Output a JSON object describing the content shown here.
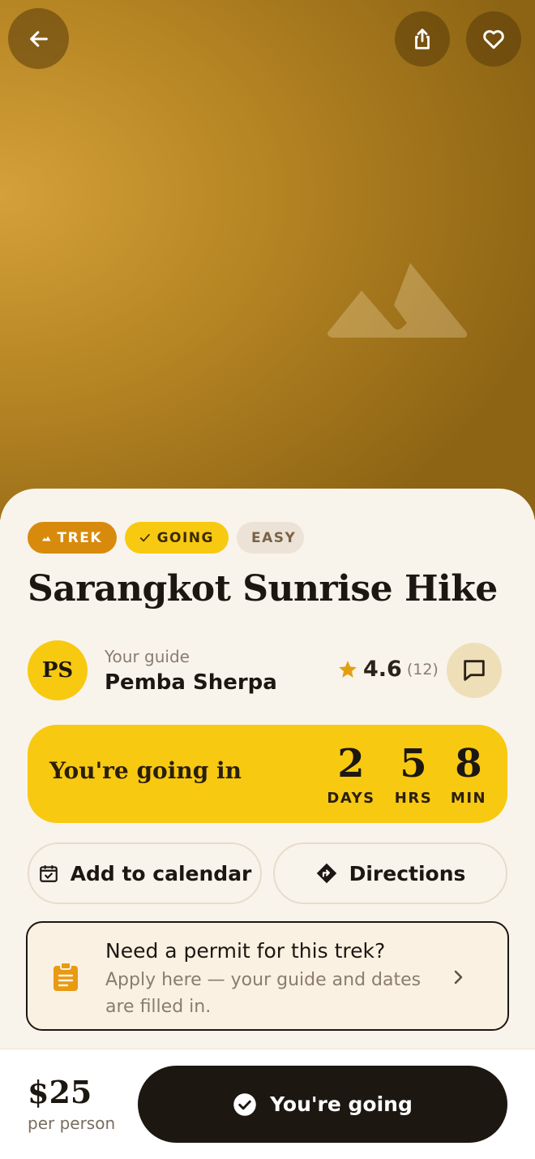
{
  "hero": {
    "back_icon": "arrow-left-icon",
    "share_icon": "share-icon",
    "favorite_icon": "heart-icon",
    "image_icon": "mountain-icon"
  },
  "tags": [
    {
      "label": "TREK",
      "icon": "mountain-icon",
      "color": "#d88a0c"
    },
    {
      "label": "GOING",
      "icon": "check-icon",
      "color": "#f8c911"
    },
    {
      "label": "EASY",
      "color": "#ece3d6"
    }
  ],
  "trek": {
    "title": "Sarangkot Sunrise Hike"
  },
  "guide": {
    "initials": "PS",
    "label": "Your guide",
    "name": "Pemba Sherpa",
    "rating": "4.6",
    "rating_count": "(12)",
    "message_icon": "chat-bubble-icon"
  },
  "countdown": {
    "label": "You're going in",
    "units": [
      {
        "value": "2",
        "label": "DAYS"
      },
      {
        "value": "5",
        "label": "HRS"
      },
      {
        "value": "8",
        "label": "MIN"
      }
    ]
  },
  "actions": {
    "calendar_label": "Add to calendar",
    "directions_label": "Directions"
  },
  "permit": {
    "title": "Need a permit for this trek?",
    "subtitle": "Apply here — your guide and dates are filled in.",
    "icon": "clipboard-icon"
  },
  "footer": {
    "price": "$25",
    "price_unit": "per person",
    "cta_label": "You're going"
  },
  "colors": {
    "accent_yellow": "#f8c911",
    "accent_orange": "#d88a0c",
    "dark": "#1d1712",
    "background": "#f8f4ec"
  }
}
